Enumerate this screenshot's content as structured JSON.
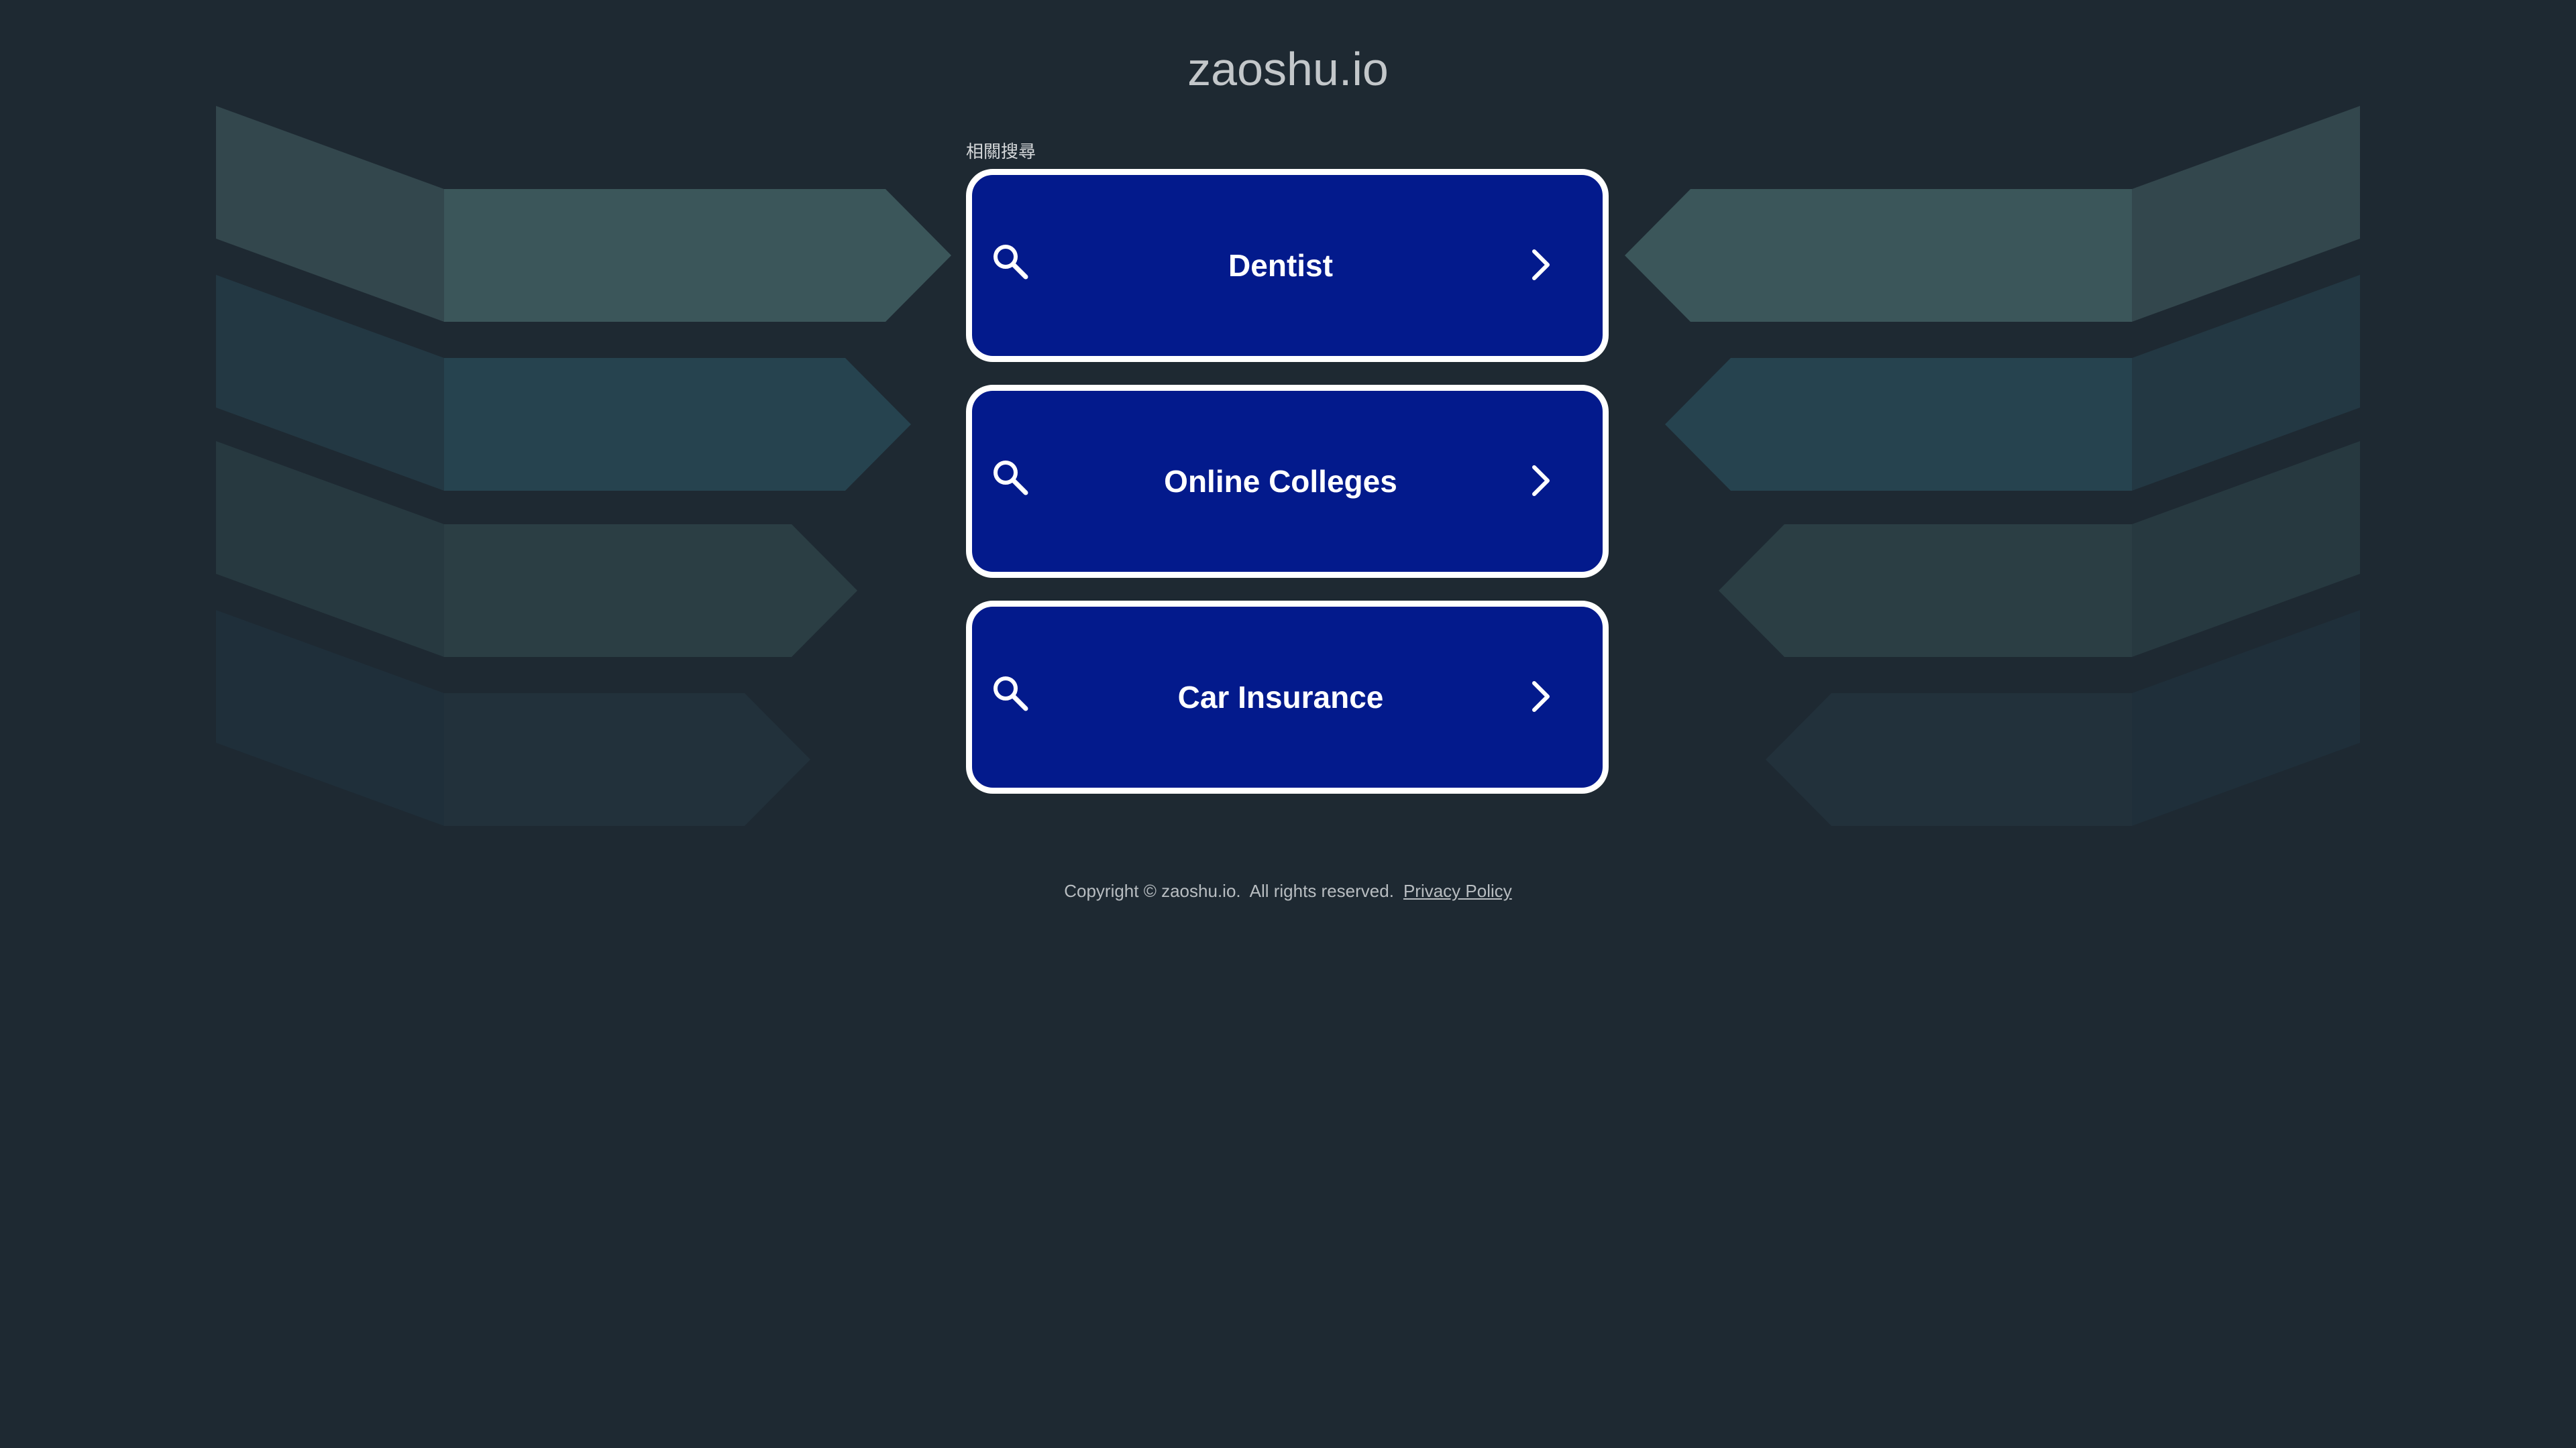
{
  "header": {
    "domain_title": "zaoshu.io"
  },
  "related": {
    "label": "相關搜尋",
    "links": [
      {
        "label": "Dentist"
      },
      {
        "label": "Online Colleges"
      },
      {
        "label": "Car Insurance"
      }
    ]
  },
  "footer": {
    "copyright": "Copyright © zaoshu.io.  All rights reserved.",
    "privacy_label": "Privacy Policy"
  },
  "icons": {
    "search": "search-icon",
    "chevron": "chevron-right-icon"
  },
  "colors": {
    "background": "#1e2932",
    "button": "#031a8c",
    "button_border": "#ffffff"
  }
}
